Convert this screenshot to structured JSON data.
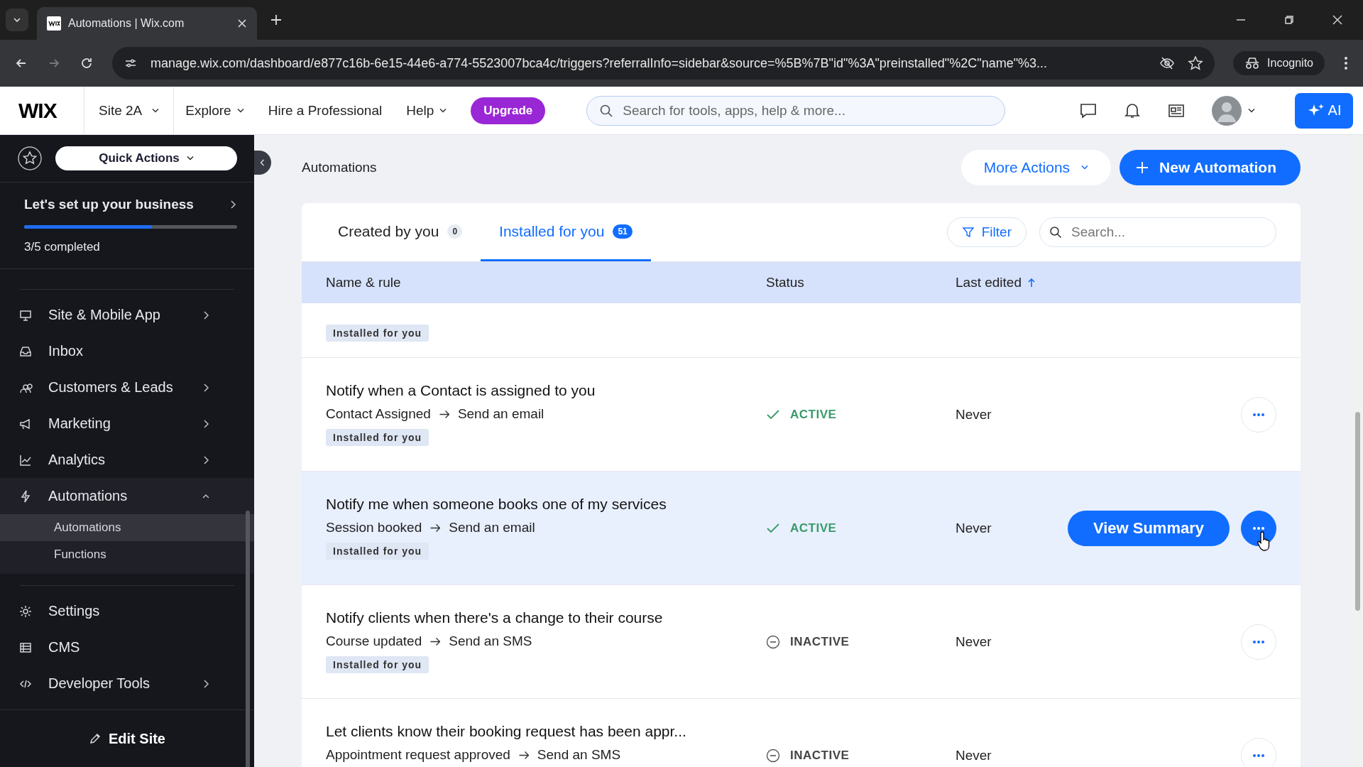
{
  "browser": {
    "tab_title": "Automations | Wix.com",
    "url": "manage.wix.com/dashboard/e877c16b-6e15-44e6-a774-5523007bca4c/triggers?referralInfo=sidebar&source=%5B%7B\"id\"%3A\"preinstalled\"%2C\"name\"%3...",
    "incognito": "Incognito"
  },
  "topbar": {
    "logo": "WIX",
    "site": "Site 2A",
    "nav": [
      {
        "label": "Explore",
        "dropdown": true
      },
      {
        "label": "Hire a Professional",
        "dropdown": false
      },
      {
        "label": "Help",
        "dropdown": true
      }
    ],
    "upgrade": "Upgrade",
    "search_placeholder": "Search for tools, apps, help & more...",
    "ai": "AI"
  },
  "sidebar": {
    "quick_actions": "Quick Actions",
    "setup_title": "Let's set up your business",
    "setup_progress": {
      "level": 0.6
    },
    "setup_status": "3/5 completed",
    "groups": [
      {
        "items": [
          {
            "label": "Site & Mobile App",
            "arrow": true,
            "expanded": false
          },
          {
            "label": "Inbox",
            "arrow": false,
            "expanded": false
          },
          {
            "label": "Customers & Leads",
            "arrow": true,
            "expanded": false
          },
          {
            "label": "Marketing",
            "arrow": true,
            "expanded": false
          },
          {
            "label": "Analytics",
            "arrow": true,
            "expanded": false
          },
          {
            "label": "Automations",
            "arrow": true,
            "expanded": true,
            "children": [
              {
                "label": "Automations",
                "selected": true
              },
              {
                "label": "Functions",
                "selected": false
              }
            ]
          }
        ]
      },
      {
        "items": [
          {
            "label": "Settings",
            "arrow": false,
            "expanded": false
          },
          {
            "label": "CMS",
            "arrow": false,
            "expanded": false
          },
          {
            "label": "Developer Tools",
            "arrow": true,
            "expanded": false
          }
        ]
      }
    ],
    "edit_site": "Edit Site"
  },
  "page": {
    "title": "Automations",
    "more_actions": "More Actions",
    "new_automation": "New Automation",
    "tabs": [
      {
        "label": "Created by you",
        "count": "0",
        "selected": false
      },
      {
        "label": "Installed for you",
        "count": "51",
        "selected": true
      }
    ],
    "filter": "Filter",
    "search_placeholder": "Search...",
    "columns": [
      {
        "label": "Name & rule",
        "sorted": false
      },
      {
        "label": "Status",
        "sorted": false
      },
      {
        "label": "Last edited",
        "sorted": true
      }
    ],
    "hover_button": "View Summary",
    "rows": [
      {
        "kind": "partial",
        "tag": "Installed for you",
        "hovered": false
      },
      {
        "kind": "full",
        "name": "Notify when a Contact is assigned to you",
        "trigger": "Contact Assigned",
        "action": "Send an email",
        "tag": "Installed for you",
        "active": true,
        "status": "ACTIVE",
        "edited": "Never",
        "hovered": false
      },
      {
        "kind": "full",
        "name": "Notify me when someone books one of my services",
        "trigger": "Session booked",
        "action": "Send an email",
        "tag": "Installed for you",
        "active": true,
        "status": "ACTIVE",
        "edited": "Never",
        "hovered": true
      },
      {
        "kind": "full",
        "name": "Notify clients when there's a change to their course",
        "trigger": "Course updated",
        "action": "Send an SMS",
        "tag": "Installed for you",
        "active": false,
        "status": "INACTIVE",
        "edited": "Never",
        "hovered": false
      },
      {
        "kind": "full",
        "name": "Let clients know their booking request has been appr...",
        "trigger": "Appointment request approved",
        "action": "Send an SMS",
        "active": false,
        "status": "INACTIVE",
        "edited": "Never",
        "hovered": false
      }
    ]
  }
}
